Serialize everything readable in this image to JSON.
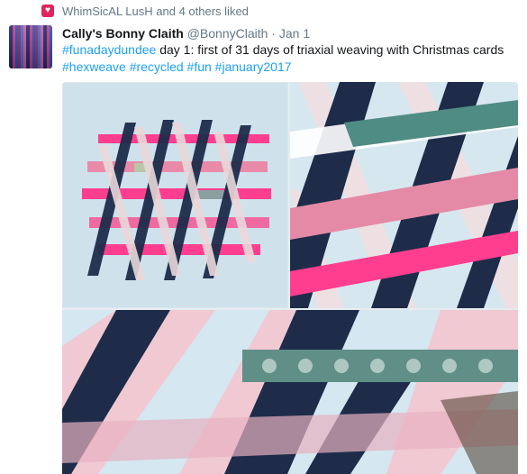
{
  "social_context": {
    "liker_name": "WhimSicAL LusH",
    "suffix": "and 4 others liked"
  },
  "tweet": {
    "author": {
      "display_name": "Cally's Bonny Claith",
      "handle": "@BonnyClaith"
    },
    "separator": "·",
    "date": "Jan 1",
    "text": {
      "lead_hashtag": "#funadaydundee",
      "body": " day 1: first of 31 days of triaxial weaving with Christmas cards ",
      "hashtags": [
        "#hexweave",
        "#recycled",
        "#fun",
        "#january2017"
      ]
    }
  },
  "media": {
    "photos": [
      {
        "alt_label": "photo-1"
      },
      {
        "alt_label": "photo-2"
      },
      {
        "alt_label": "photo-3"
      }
    ]
  },
  "colors": {
    "heart": "#e0245e",
    "link": "#1da1f2",
    "muted": "#657786",
    "background_card": "#cfe2ec",
    "strip_navy": "#1e2c4a",
    "strip_pink": "#ff3e8f",
    "strip_light": "#f3dfe0"
  }
}
